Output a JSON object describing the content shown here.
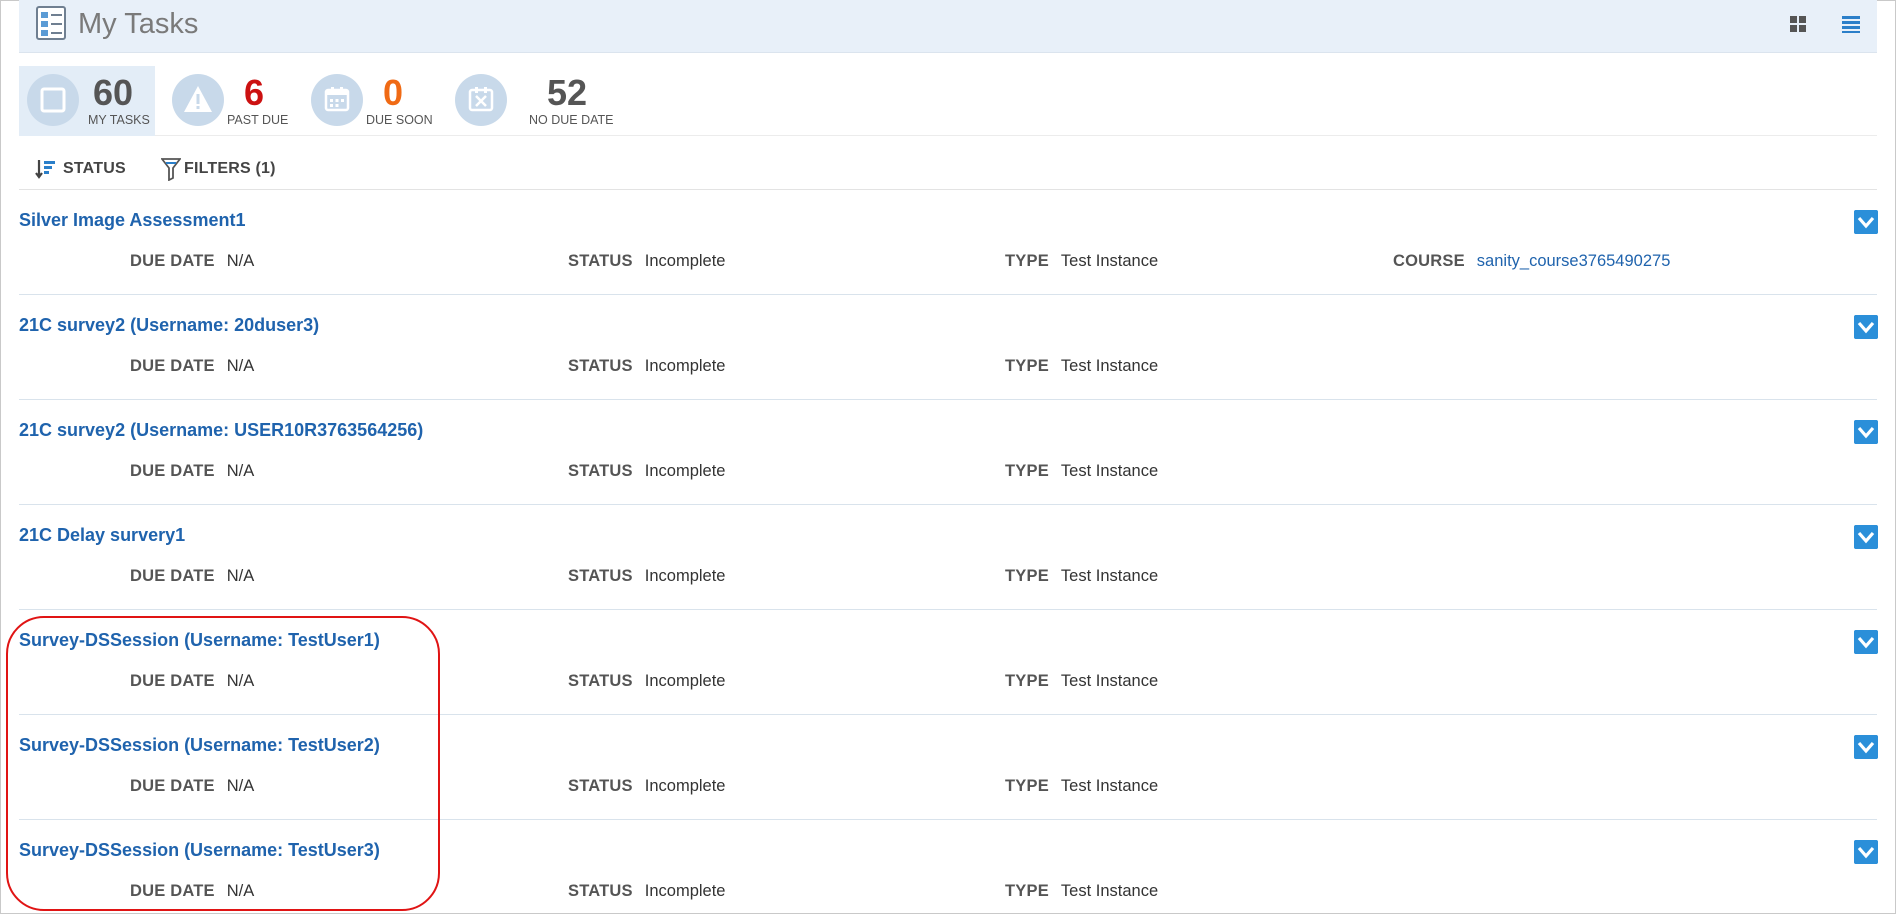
{
  "header": {
    "title": "My Tasks",
    "icons": {
      "app": "task-board-icon",
      "grid_view": "grid-view-icon",
      "list_view": "list-view-icon"
    }
  },
  "stats": [
    {
      "value": "60",
      "label": "MY TASKS",
      "color": "#555555",
      "icon": "checkbox-icon",
      "active": true
    },
    {
      "value": "6",
      "label": "PAST DUE",
      "color": "#cc1111",
      "icon": "warning-icon",
      "active": false
    },
    {
      "value": "0",
      "label": "DUE SOON",
      "color": "#f06a14",
      "icon": "calendar-icon",
      "active": false
    },
    {
      "value": "52",
      "label": "NO DUE DATE",
      "color": "#555555",
      "icon": "calendar-x-icon",
      "active": false
    }
  ],
  "toolbar": {
    "sort_label": "STATUS",
    "filter_label": "FILTERS (1)",
    "icons": {
      "sort": "sort-icon",
      "filter": "filter-icon"
    }
  },
  "labels": {
    "due_date": "DUE DATE",
    "status": "STATUS",
    "type": "TYPE",
    "course": "COURSE"
  },
  "tasks": [
    {
      "name": "Silver Image Assessment1",
      "due_date": "N/A",
      "status": "Incomplete",
      "type": "Test Instance",
      "course": "sanity_course3765490275"
    },
    {
      "name": "21C survey2 (Username: 20duser3)",
      "due_date": "N/A",
      "status": "Incomplete",
      "type": "Test Instance"
    },
    {
      "name": "21C survey2 (Username: USER10R3763564256)",
      "due_date": "N/A",
      "status": "Incomplete",
      "type": "Test Instance"
    },
    {
      "name": "21C Delay survery1",
      "due_date": "N/A",
      "status": "Incomplete",
      "type": "Test Instance"
    },
    {
      "name": "Survey-DSSession (Username: TestUser1)",
      "due_date": "N/A",
      "status": "Incomplete",
      "type": "Test Instance"
    },
    {
      "name": "Survey-DSSession (Username: TestUser2)",
      "due_date": "N/A",
      "status": "Incomplete",
      "type": "Test Instance"
    },
    {
      "name": "Survey-DSSession (Username: TestUser3)",
      "due_date": "N/A",
      "status": "Incomplete",
      "type": "Test Instance"
    }
  ],
  "colors": {
    "accent": "#1f63ad",
    "header_bg": "#e8f0f9",
    "expand_button": "#2b8fd9",
    "highlight": "#e01414"
  }
}
